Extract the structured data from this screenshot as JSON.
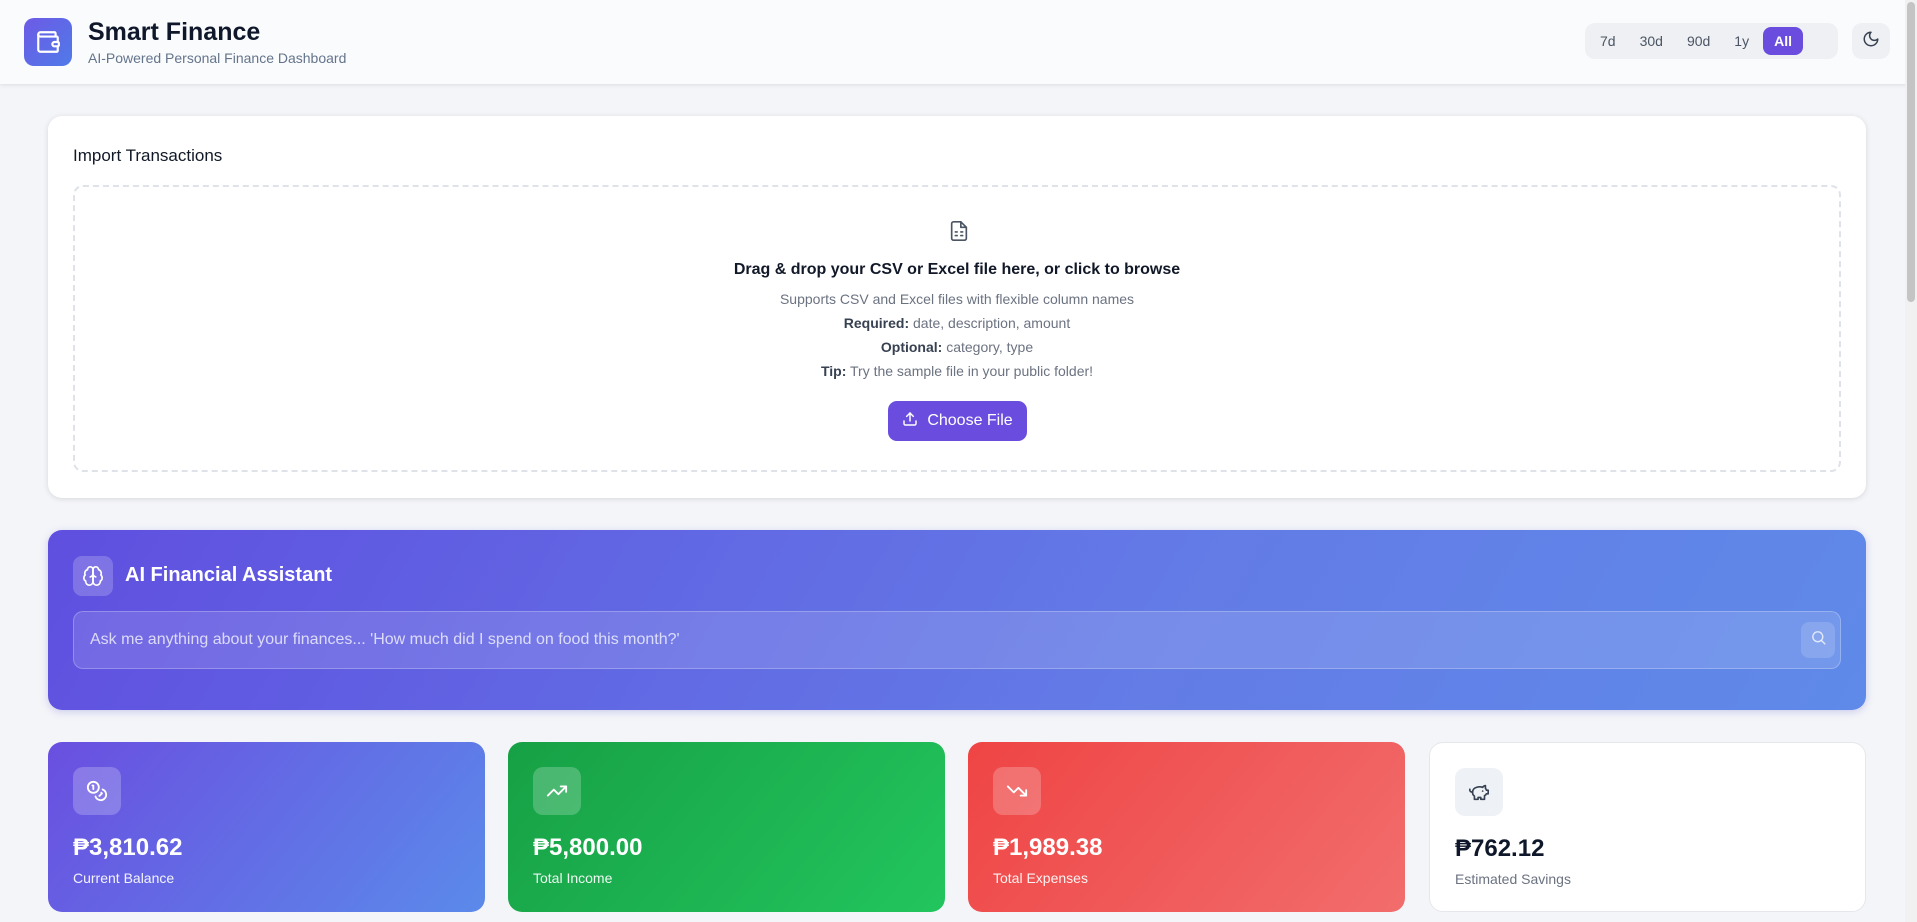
{
  "header": {
    "title": "Smart Finance",
    "subtitle": "AI-Powered Personal Finance Dashboard",
    "logo_icon": "wallet-icon",
    "ranges": [
      {
        "label": "7d",
        "active": false
      },
      {
        "label": "30d",
        "active": false
      },
      {
        "label": "90d",
        "active": false
      },
      {
        "label": "1y",
        "active": false
      },
      {
        "label": "All",
        "active": true
      }
    ],
    "theme_icon": "moon-icon"
  },
  "import": {
    "title": "Import Transactions",
    "icon": "file-spreadsheet-icon",
    "main_text": "Drag & drop your CSV or Excel file here, or click to browse",
    "supports": "Supports CSV and Excel files with flexible column names",
    "required_label": "Required:",
    "required_value": "date, description, amount",
    "optional_label": "Optional:",
    "optional_value": "category, type",
    "tip_label": "Tip:",
    "tip_value": "Try the sample file in your public folder!",
    "button_label": "Choose File",
    "button_icon": "upload-icon"
  },
  "assistant": {
    "title": "AI Financial Assistant",
    "icon": "brain-icon",
    "placeholder": "Ask me anything about your finances... 'How much did I spend on food this month?'",
    "search_icon": "search-icon"
  },
  "stats": [
    {
      "value": "₱3,810.62",
      "label": "Current Balance",
      "icon": "coins-icon"
    },
    {
      "value": "₱5,800.00",
      "label": "Total Income",
      "icon": "trending-up-icon"
    },
    {
      "value": "₱1,989.38",
      "label": "Total Expenses",
      "icon": "trending-down-icon"
    },
    {
      "value": "₱762.12",
      "label": "Estimated Savings",
      "icon": "piggy-bank-icon"
    }
  ],
  "colors": {
    "accent": "#6a4ddf",
    "income": "#22c55e",
    "expense": "#ef4444"
  }
}
